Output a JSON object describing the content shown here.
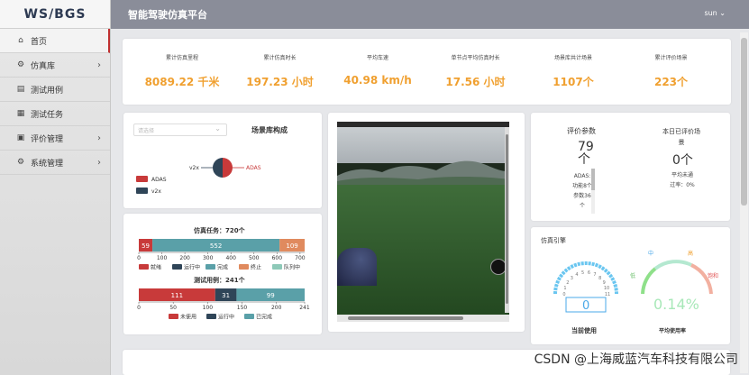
{
  "app": {
    "logo": "WS/BGS",
    "title": "智能驾驶仿真平台",
    "user": "sun ⌄"
  },
  "sidebar": {
    "items": [
      {
        "label": "首页",
        "icon": "home-icon",
        "glyph": "⌂"
      },
      {
        "label": "仿真库",
        "icon": "library-icon",
        "glyph": "⚙",
        "chev": "›"
      },
      {
        "label": "测试用例",
        "icon": "document-icon",
        "glyph": "▤"
      },
      {
        "label": "测试任务",
        "icon": "task-icon",
        "glyph": "▦"
      },
      {
        "label": "评价管理",
        "icon": "evaluation-icon",
        "glyph": "▣",
        "chev": "›"
      },
      {
        "label": "系统管理",
        "icon": "gear-icon",
        "glyph": "⚙",
        "chev": "›"
      }
    ]
  },
  "stats": [
    {
      "label": "累计仿真里程",
      "value": "8089.22 千米"
    },
    {
      "label": "累计仿真时长",
      "value": "197.23 小时"
    },
    {
      "label": "平均车速",
      "value": "40.98 km/h"
    },
    {
      "label": "单节点平均仿真时长",
      "value": "17.56 小时"
    },
    {
      "label": "场景库共计场景",
      "value": "1107个"
    },
    {
      "label": "累计评价场景",
      "value": "223个"
    }
  ],
  "scene_panel": {
    "select_placeholder": "请选择",
    "title": "场景库构成",
    "legend": [
      "ADAS",
      "v2x"
    ],
    "pie_labels": {
      "left": "v2x",
      "right": "ADAS"
    }
  },
  "task_panel": {
    "task_title": "仿真任务：720个",
    "case_title": "测试用例：241个",
    "task_legend": [
      "就绪",
      "运行中",
      "完成",
      "终止",
      "队列中"
    ],
    "case_legend": [
      "未使用",
      "运行中",
      "已完成"
    ]
  },
  "eval_panel": {
    "left_title": "评价参数",
    "left_value": "79个",
    "left_lines": [
      "ADAS:",
      "功能8个",
      "参数36",
      "个"
    ],
    "right_title": "本日已评价场景",
    "right_value": "0个",
    "right_lines": [
      "平均未通",
      "过率：0%"
    ]
  },
  "engine_panel": {
    "title": "仿真引擎",
    "left_value": "0",
    "left_label": "当前使用",
    "right_value": "0.14%",
    "right_label": "平均使用率",
    "left_ticks": [
      "0",
      "1",
      "2",
      "3",
      "4",
      "5",
      "6",
      "7",
      "8",
      "9",
      "10",
      "11"
    ],
    "right_ticks": {
      "low": "低",
      "mid": "中",
      "high": "高",
      "over": "饱和"
    }
  },
  "watermark": "CSDN @上海威蓝汽车科技有限公司",
  "colors": {
    "accent": "#f0a030",
    "red": "#c83a3a",
    "navy": "#2f4558",
    "teal": "#5aa0a8",
    "orange": "#e08a5e",
    "mint": "#8ec9b8"
  },
  "chart_data": [
    {
      "type": "pie",
      "categories": [
        "ADAS",
        "v2x"
      ],
      "values": [
        50,
        50
      ],
      "title": "场景库构成"
    },
    {
      "type": "bar",
      "orientation": "horizontal-stacked",
      "title": "仿真任务：720个",
      "categories": [
        "就绪",
        "运行中",
        "完成",
        "终止",
        "队列中"
      ],
      "values": [
        59,
        0,
        552,
        109,
        0
      ],
      "xlim": [
        0,
        720
      ],
      "xticks": [
        0,
        100,
        200,
        300,
        400,
        500,
        600,
        700
      ]
    },
    {
      "type": "bar",
      "orientation": "horizontal-stacked",
      "title": "测试用例：241个",
      "categories": [
        "未使用",
        "运行中",
        "已完成"
      ],
      "values": [
        111,
        31,
        99
      ],
      "xlim": [
        0,
        241
      ],
      "xticks": [
        0,
        50,
        100,
        150,
        200,
        241
      ]
    }
  ]
}
